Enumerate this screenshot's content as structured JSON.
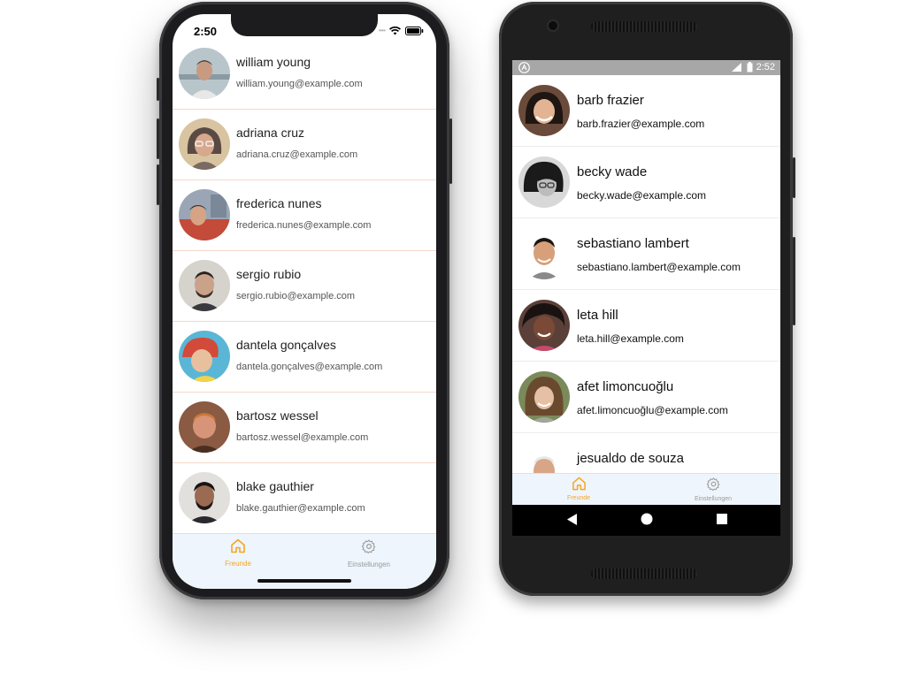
{
  "ios": {
    "status_time": "2:50",
    "contacts": [
      {
        "name": "william young",
        "email": "william.young@example.com"
      },
      {
        "name": "adriana cruz",
        "email": "adriana.cruz@example.com"
      },
      {
        "name": "frederica nunes",
        "email": "frederica.nunes@example.com"
      },
      {
        "name": "sergio rubio",
        "email": "sergio.rubio@example.com"
      },
      {
        "name": "dantela gonçalves",
        "email": "dantela.gonçalves@example.com"
      },
      {
        "name": "bartosz wessel",
        "email": "bartosz.wessel@example.com"
      },
      {
        "name": "blake gauthier",
        "email": "blake.gauthier@example.com"
      }
    ],
    "tabs": [
      {
        "label": "Freunde",
        "icon": "home-icon",
        "active": true
      },
      {
        "label": "Einstellungen",
        "icon": "gear-icon",
        "active": false
      }
    ]
  },
  "android": {
    "status_time": "2:52",
    "contacts": [
      {
        "name": "barb frazier",
        "email": "barb.frazier@example.com"
      },
      {
        "name": "becky wade",
        "email": "becky.wade@example.com"
      },
      {
        "name": "sebastiano lambert",
        "email": "sebastiano.lambert@example.com"
      },
      {
        "name": "leta hill",
        "email": "leta.hill@example.com"
      },
      {
        "name": "afet limoncuoğlu",
        "email": "afet.limoncuoğlu@example.com"
      },
      {
        "name": "jesualdo de souza",
        "email": ""
      }
    ],
    "tabs": [
      {
        "label": "Freunde",
        "icon": "home-icon",
        "active": true
      },
      {
        "label": "Einstellungen",
        "icon": "gear-icon",
        "active": false
      }
    ],
    "nav_buttons": [
      "back-icon",
      "home-circle-icon",
      "recents-icon"
    ]
  },
  "colors": {
    "accent": "#f5a623",
    "inactive": "#9a9a9a",
    "tabbar_bg": "#eef5fc",
    "ios_separator": "#f6d8c8",
    "android_status_bar": "#a7a7a7"
  }
}
